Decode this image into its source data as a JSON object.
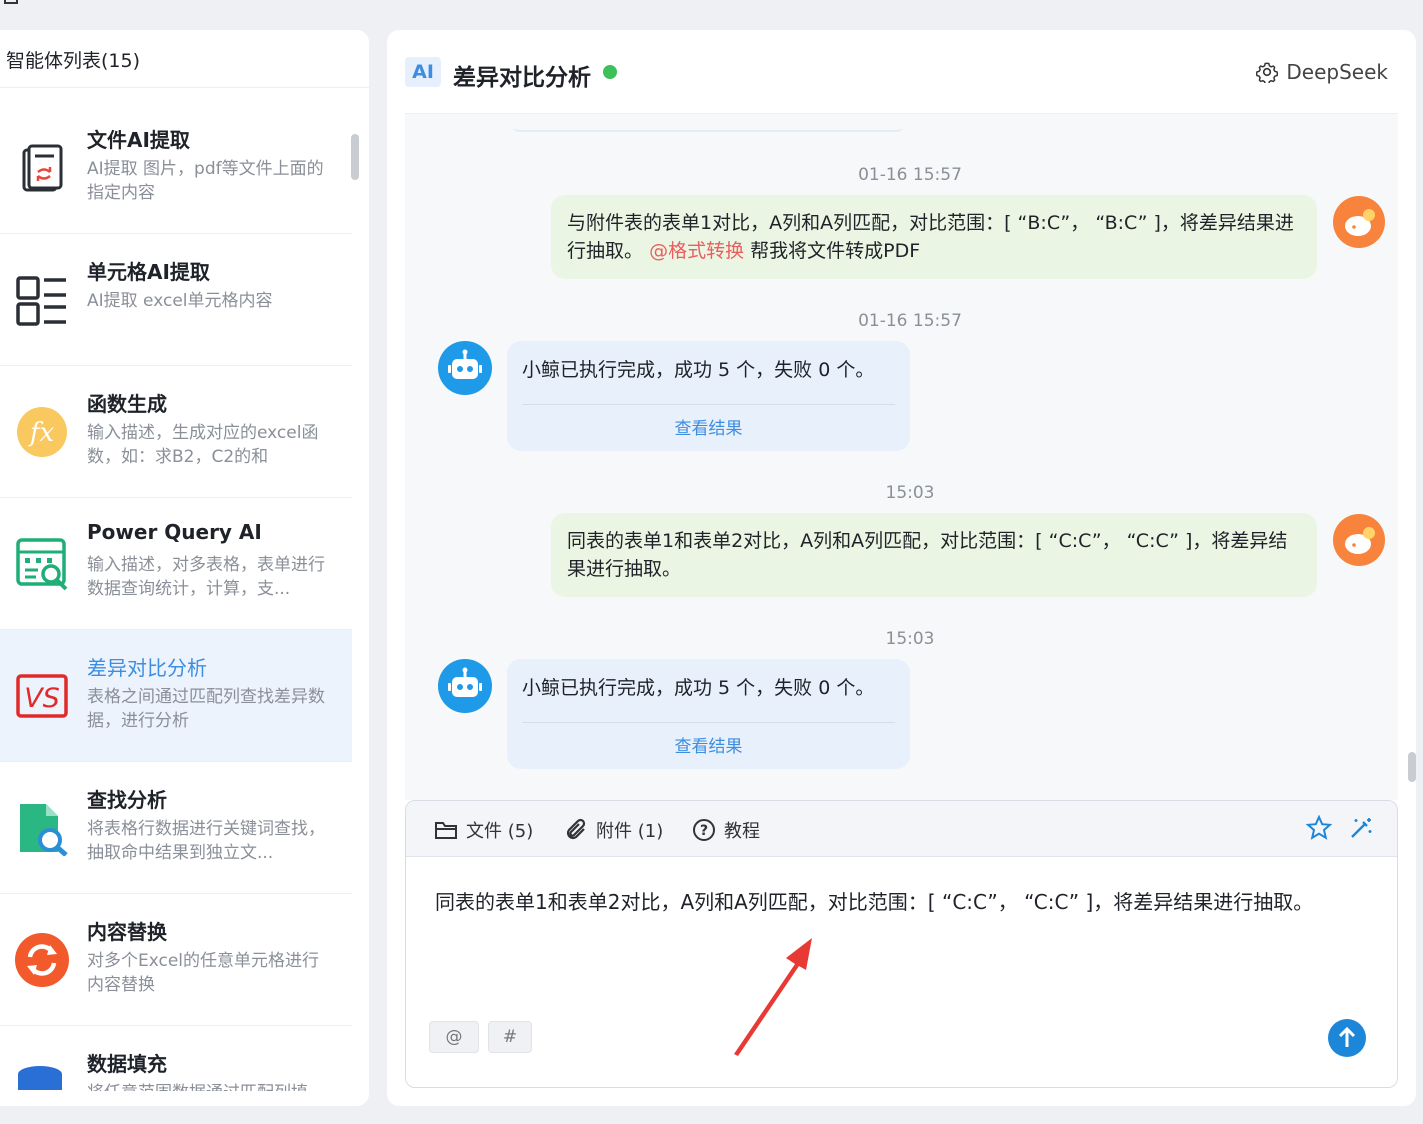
{
  "sidebar": {
    "header": "智能体列表(15)",
    "items": [
      {
        "title": "文件AI提取",
        "desc": "AI提取 图片，pdf等文件上面的指定内容",
        "icon": "document-extract-icon"
      },
      {
        "title": "单元格AI提取",
        "desc": "AI提取 excel单元格内容",
        "icon": "list-layout-icon"
      },
      {
        "title": "函数生成",
        "desc": "输入描述，生成对应的excel函数，如：求B2，C2的和",
        "icon": "fx-function-icon"
      },
      {
        "title": "Power Query AI",
        "desc": "输入描述，对多表格，表单进行数据查询统计，计算，支...",
        "icon": "query-table-icon"
      },
      {
        "title": "差异对比分析",
        "desc": "表格之间通过匹配列查找差异数据，进行分析",
        "icon": "vs-compare-icon",
        "active": true
      },
      {
        "title": "查找分析",
        "desc": "将表格行数据进行关键词查找，抽取命中结果到独立文...",
        "icon": "file-search-icon"
      },
      {
        "title": "内容替换",
        "desc": "对多个Excel的任意单元格进行内容替换",
        "icon": "replace-sync-icon"
      },
      {
        "title": "数据填充",
        "desc": "将任意范围数据通过匹配列填",
        "icon": "database-fill-icon"
      }
    ]
  },
  "header": {
    "badge": "AI",
    "title": "差异对比分析",
    "status_color": "#3cc05a",
    "model": "DeepSeek"
  },
  "messages": [
    {
      "type": "timestamp",
      "text": "01-16 15:57"
    },
    {
      "type": "user",
      "text_before": "与附件表的表单1对比，A列和A列匹配，对比范围：[ “B:C”， “B:C” ]，将差异结果进行抽取。",
      "mention": "@格式转换",
      "text_after": " 帮我将文件转成PDF"
    },
    {
      "type": "timestamp",
      "text": "01-16 15:57"
    },
    {
      "type": "bot",
      "text": "小鲸已执行完成，成功 5 个，失败 0 个。",
      "link": "查看结果"
    },
    {
      "type": "timestamp",
      "text": "15:03"
    },
    {
      "type": "user",
      "text_before": "同表的表单1和表单2对比，A列和A列匹配，对比范围：[ “C:C”， “C:C” ]，将差异结果进行抽取。",
      "mention": "",
      "text_after": ""
    },
    {
      "type": "timestamp",
      "text": "15:03"
    },
    {
      "type": "bot",
      "text": "小鲸已执行完成，成功 5 个，失败 0 个。",
      "link": "查看结果"
    }
  ],
  "composer": {
    "files_label": "文件 (5)",
    "attachments_label": "附件 (1)",
    "tutorial_label": "教程",
    "input_text": "同表的表单1和表单2对比，A列和A列匹配，对比范围：[ “C:C”， “C:C” ]，将差异结果进行抽取。",
    "chip_at": "@",
    "chip_hash": "#"
  },
  "colors": {
    "accent": "#3d8ee0",
    "user_bubble": "#eaf6e3",
    "bot_bubble": "#e8f0fc",
    "send_button": "#1c87d9",
    "annotation_arrow": "#e83a34"
  }
}
